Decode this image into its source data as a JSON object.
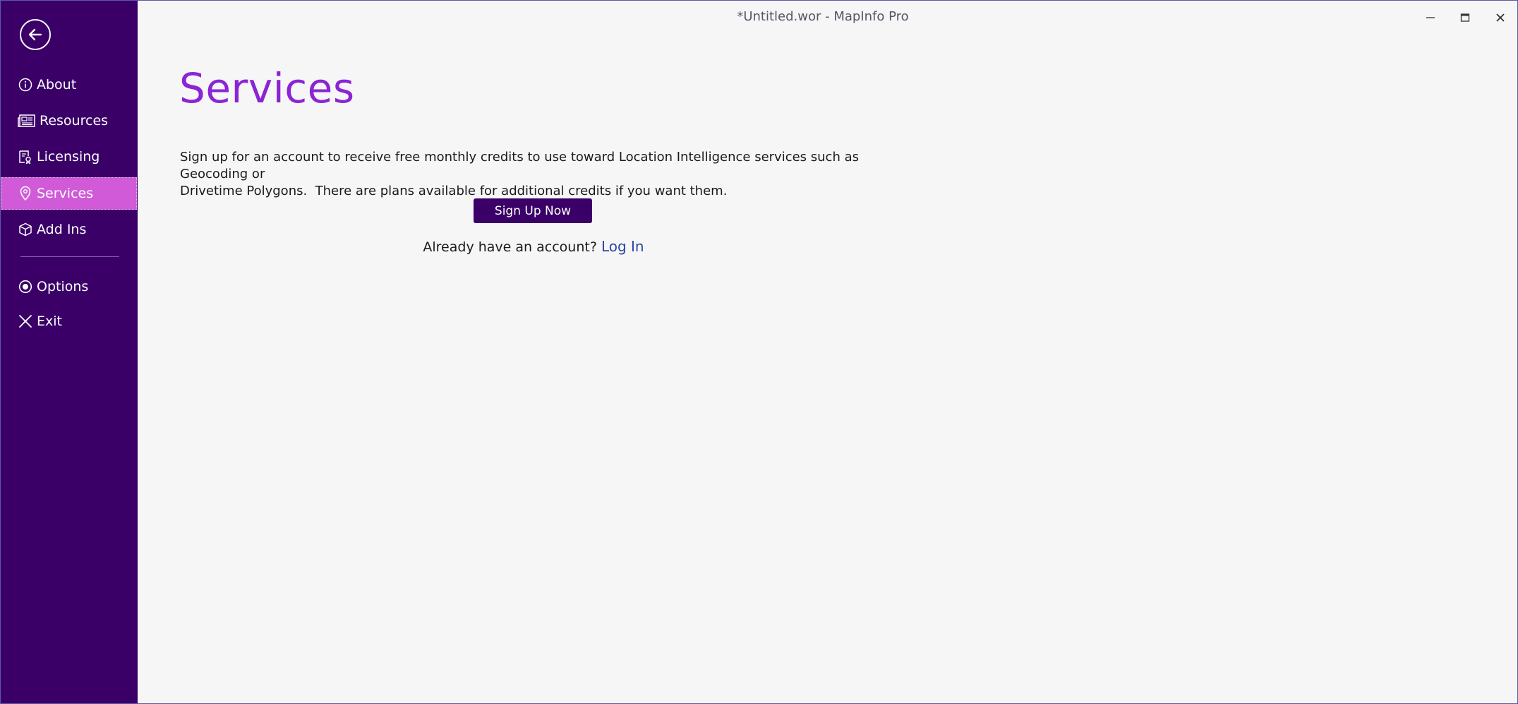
{
  "window": {
    "title": "*Untitled.wor - MapInfo Pro"
  },
  "sidebar": {
    "back_icon": "back-arrow-icon",
    "items": [
      {
        "label": "About",
        "icon": "info-icon"
      },
      {
        "label": "Resources",
        "icon": "newspaper-icon"
      },
      {
        "label": "Licensing",
        "icon": "license-icon"
      },
      {
        "label": "Services",
        "icon": "location-pin-icon",
        "active": true
      },
      {
        "label": "Add Ins",
        "icon": "cube-icon"
      }
    ],
    "footer_items": [
      {
        "label": "Options",
        "icon": "radio-options-icon"
      },
      {
        "label": "Exit",
        "icon": "close-icon"
      }
    ]
  },
  "main": {
    "title": "Services",
    "description_line1": "Sign up for an account to receive free monthly credits to use toward Location Intelligence services such as Geocoding or",
    "description_line2": "Drivetime Polygons.  There are plans available for additional credits if you want them.",
    "signup_label": "Sign Up Now",
    "account_prompt": "Already have an account?",
    "login_label": "Log In"
  },
  "colors": {
    "sidebar_bg": "#3a0068",
    "active_item": "#d05ad8",
    "title": "#8a24d4",
    "link": "#2a45a0",
    "page_bg": "#f6f6f6"
  }
}
